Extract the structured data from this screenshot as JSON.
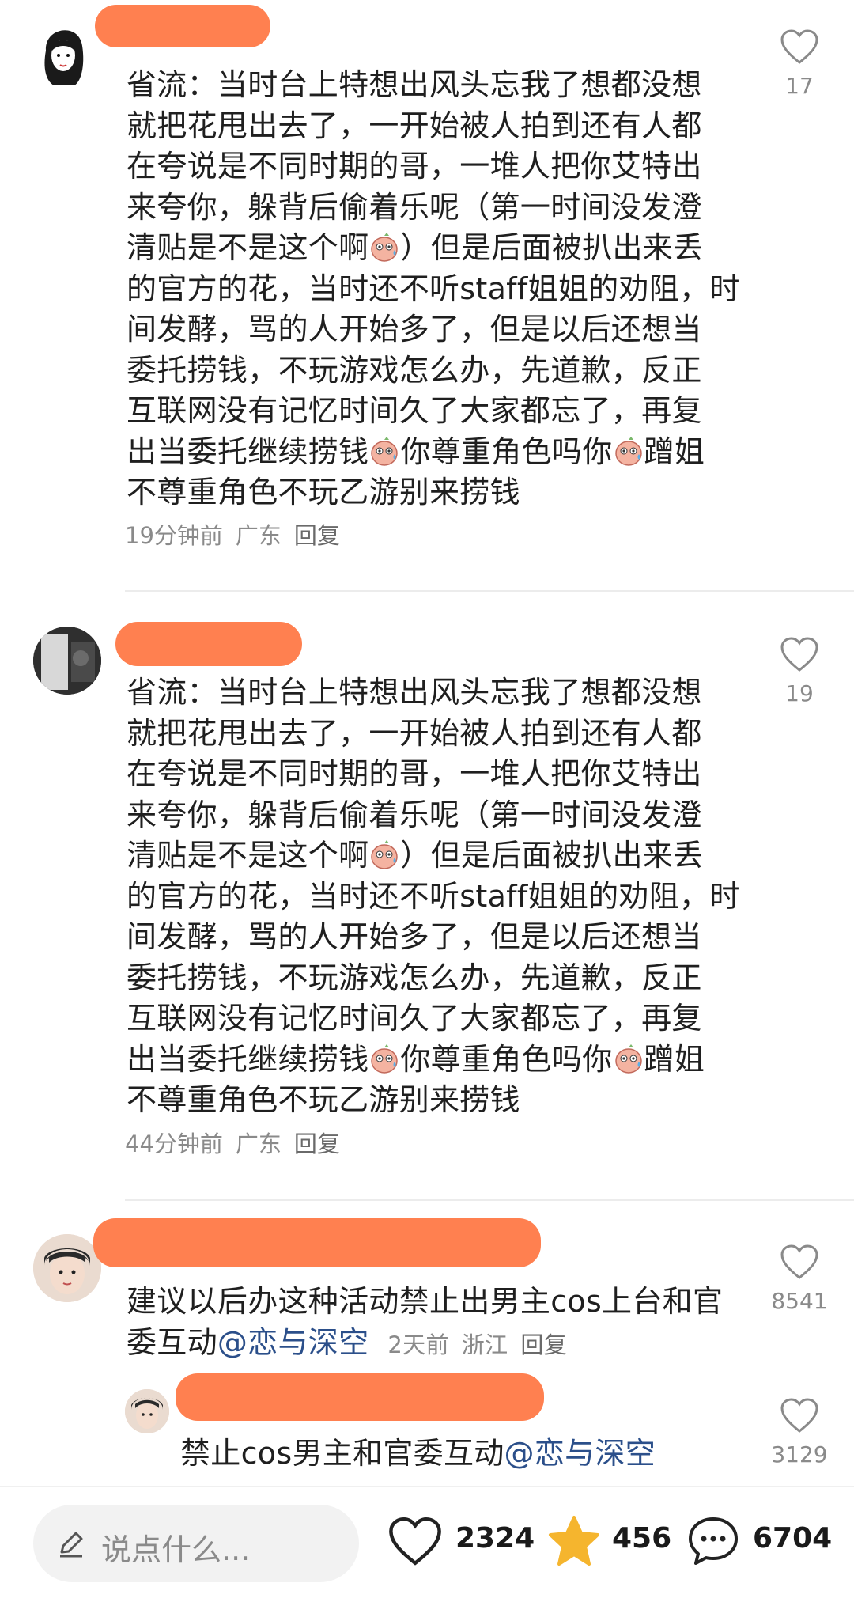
{
  "comments": [
    {
      "text_lines": [
        "省流：当时台上特想出风头忘我了想都没想",
        "就把花甩出去了，一开始被人拍到还有人都",
        "在夸说是不同时期的哥，一堆人把你艾特出",
        "来夸你，躲背后偷着乐呢（第一时间没发澄",
        "清贴是不是这个啊",
        "）但是后面被扒出来丢",
        "的官方的花，当时还不听staff姐姐的劝阻，时",
        "间发酵，骂的人开始多了，但是以后还想当",
        "委托捞钱，不玩游戏怎么办，先道歉，反正",
        "互联网没有记忆时间久了大家都忘了，再复",
        "出当委托继续捞钱",
        "你尊重角色吗你",
        "蹭姐",
        "不尊重角色不玩乙游别来捞钱"
      ],
      "time": "19分钟前",
      "location": "广东",
      "reply": "回复",
      "likes": "17"
    },
    {
      "text_lines": [
        "省流：当时台上特想出风头忘我了想都没想",
        "就把花甩出去了，一开始被人拍到还有人都",
        "在夸说是不同时期的哥，一堆人把你艾特出",
        "来夸你，躲背后偷着乐呢（第一时间没发澄",
        "清贴是不是这个啊",
        "）但是后面被扒出来丢",
        "的官方的花，当时还不听staff姐姐的劝阻，时",
        "间发酵，骂的人开始多了，但是以后还想当",
        "委托捞钱，不玩游戏怎么办，先道歉，反正",
        "互联网没有记忆时间久了大家都忘了，再复",
        "出当委托继续捞钱",
        "你尊重角色吗你",
        "蹭姐",
        "不尊重角色不玩乙游别来捞钱"
      ],
      "time": "44分钟前",
      "location": "广东",
      "reply": "回复",
      "likes": "19"
    },
    {
      "text_line1": "建议以后办这种活动禁止出男主cos上台和官",
      "text_line2_prefix": "委互动",
      "mention": "@恋与深空",
      "time": "2天前",
      "location": "浙江",
      "reply": "回复",
      "likes": "8541"
    },
    {
      "text_prefix": "禁止cos男主和官委互动",
      "mention": "@恋与深空",
      "likes": "3129"
    }
  ],
  "bottom_bar": {
    "input_placeholder": "说点什么...",
    "like_count": "2324",
    "star_count": "456",
    "comment_count": "6704"
  },
  "icons": {
    "like": "heart-outline-icon",
    "star": "star-icon",
    "comment": "chat-bubble-icon",
    "edit": "pencil-icon"
  },
  "colors": {
    "redaction": "#ff8050",
    "star": "#f5b52e",
    "mention": "#2b4f8a",
    "meta": "#8a8a8a"
  }
}
